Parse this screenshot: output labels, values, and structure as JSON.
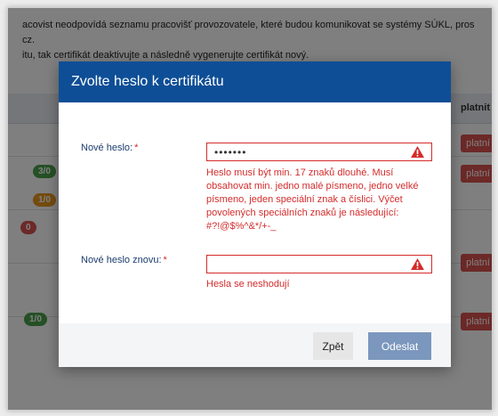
{
  "background": {
    "line1": "acovist neodpovídá seznamu pracovišť provozovatele, které budou komunikovat se systémy SÚKL, pros",
    "line2": "cz.",
    "line3": "itu, tak certifikát deaktivujte a následně vygenerujte certifikát nový.",
    "status_column_header": "platnit",
    "badges": [
      "3/0",
      "1/0",
      "0",
      "1/0"
    ],
    "status_labels": [
      "platní",
      "platní",
      "platní",
      "platní"
    ]
  },
  "modal": {
    "title": "Zvolte heslo k certifikátu",
    "new_password": {
      "label": "Nové heslo:",
      "required_mark": "*",
      "value": "•••••••",
      "error": "Heslo musí být min. 17 znaků dlouhé. Musí obsahovat min. jedno malé písmeno, jedno velké písmeno, jeden speciální znak a číslici. Výčet povolených speciálních znaků je následující: #?!@$%^&*/+-_"
    },
    "repeat_password": {
      "label": "Nové heslo znovu:",
      "required_mark": "*",
      "value": "",
      "error": "Hesla se neshodují"
    },
    "buttons": {
      "back": "Zpět",
      "submit": "Odeslat"
    }
  },
  "icons": {
    "field_warning": "warning-triangle-icon"
  },
  "colors": {
    "header": "#0e4e96",
    "error": "#d42b2b",
    "submit": "#7b97bd"
  }
}
